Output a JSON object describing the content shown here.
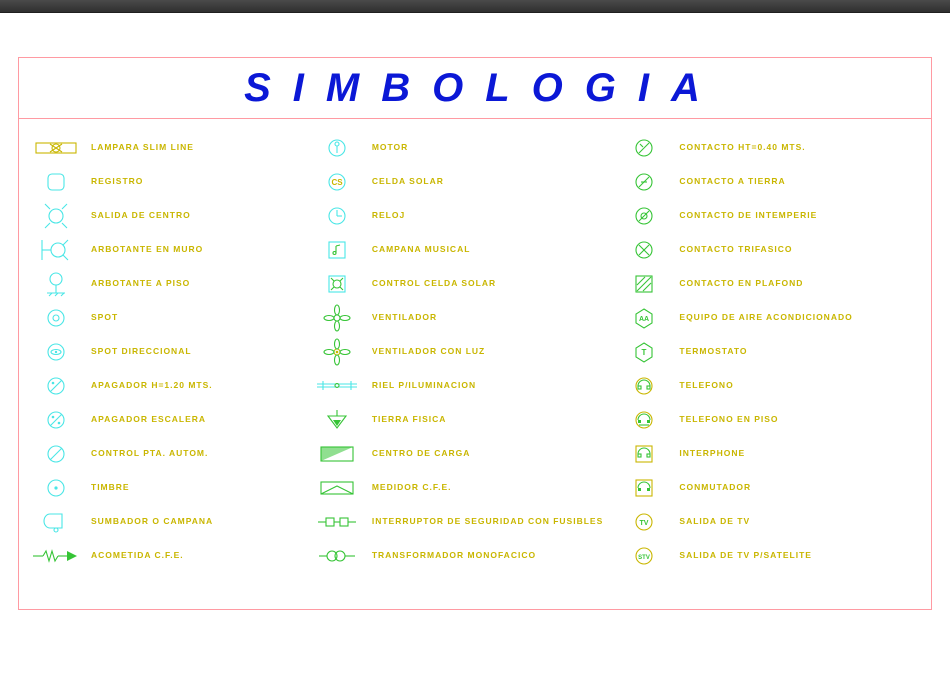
{
  "title": "SIMBOLOGIA",
  "columns": {
    "a": [
      {
        "icon": "lampara-slim-icon",
        "label": "LAMPARA SLIM LINE"
      },
      {
        "icon": "registro-icon",
        "label": "REGISTRO"
      },
      {
        "icon": "salida-centro-icon",
        "label": "SALIDA DE CENTRO"
      },
      {
        "icon": "arbotante-muro-icon",
        "label": "ARBOTANTE EN MURO"
      },
      {
        "icon": "arbotante-piso-icon",
        "label": "ARBOTANTE A PISO"
      },
      {
        "icon": "spot-icon",
        "label": "SPOT"
      },
      {
        "icon": "spot-direccional-icon",
        "label": "SPOT DIRECCIONAL"
      },
      {
        "icon": "apagador-h120-icon",
        "label": "APAGADOR h=1.20 mts."
      },
      {
        "icon": "apagador-escalera-icon",
        "label": "APAGADOR ESCALERA"
      },
      {
        "icon": "control-pta-icon",
        "label": "CONTROL PTA. AUTOM."
      },
      {
        "icon": "timbre-icon",
        "label": "TIMBRE"
      },
      {
        "icon": "sumbador-icon",
        "label": "SUMBADOR O CAMPANA"
      },
      {
        "icon": "acometida-icon",
        "label": "ACOMETIDA C.F.E."
      }
    ],
    "b": [
      {
        "icon": "motor-icon",
        "label": "MOTOR"
      },
      {
        "icon": "celda-solar-icon",
        "label": "CELDA SOLAR"
      },
      {
        "icon": "reloj-icon",
        "label": "RELOJ"
      },
      {
        "icon": "campana-musical-icon",
        "label": "CAMPANA MUSICAL"
      },
      {
        "icon": "control-celda-icon",
        "label": "CONTROL CELDA SOLAR"
      },
      {
        "icon": "ventilador-icon",
        "label": "VENTILADOR"
      },
      {
        "icon": "ventilador-luz-icon",
        "label": "VENTILADOR CON LUZ"
      },
      {
        "icon": "riel-ilum-icon",
        "label": "RIEL P/ILUMINACION"
      },
      {
        "icon": "tierra-fisica-icon",
        "label": "TIERRA FISICA"
      },
      {
        "icon": "centro-carga-icon",
        "label": "CENTRO DE CARGA"
      },
      {
        "icon": "medidor-cfe-icon",
        "label": "MEDIDOR C.F.E."
      },
      {
        "icon": "interruptor-seg-icon",
        "label": "INTERRUPTOR DE SEGURIDAD CON FUSIBLES"
      },
      {
        "icon": "transformador-icon",
        "label": "TRANSFORMADOR MONOFACICO"
      }
    ],
    "c": [
      {
        "icon": "contacto-ht-icon",
        "label": "CONTACTO HT=0.40 mts."
      },
      {
        "icon": "contacto-tierra-icon",
        "label": "CONTACTO A TIERRA"
      },
      {
        "icon": "contacto-intemp-icon",
        "label": "CONTACTO DE INTEMPERIE"
      },
      {
        "icon": "contacto-trif-icon",
        "label": "CONTACTO TRIFASICO"
      },
      {
        "icon": "contacto-plafond-icon",
        "label": "CONTACTO EN PLAFOND"
      },
      {
        "icon": "aire-acond-icon",
        "label": "EQUIPO DE AIRE ACONDICIONADO"
      },
      {
        "icon": "termostato-icon",
        "label": "TERMOSTATO"
      },
      {
        "icon": "telefono-icon",
        "label": "TELEFONO"
      },
      {
        "icon": "telefono-piso-icon",
        "label": "TELEFONO EN PISO"
      },
      {
        "icon": "interphone-icon",
        "label": "INTERPHONE"
      },
      {
        "icon": "conmutador-icon",
        "label": "CONMUTADOR"
      },
      {
        "icon": "salida-tv-icon",
        "label": "SALIDA DE TV"
      },
      {
        "icon": "salida-tv-sat-icon",
        "label": "SALIDA DE TV P/SATELITE"
      }
    ]
  }
}
